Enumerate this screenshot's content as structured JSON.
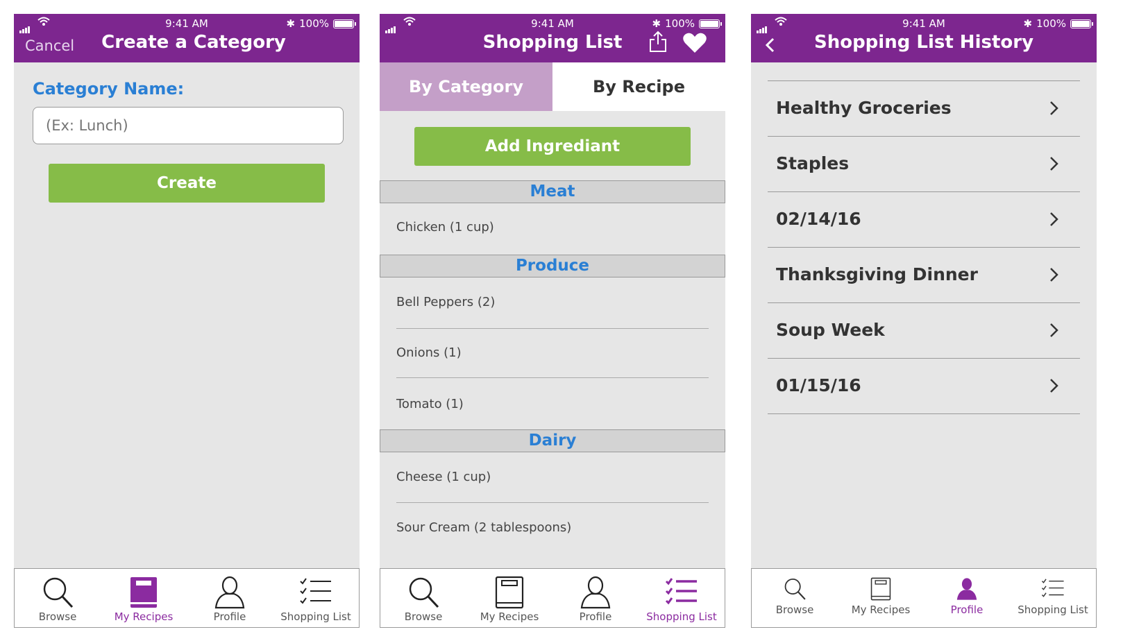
{
  "status": {
    "time": "9:41 AM",
    "battery": "100%"
  },
  "screen1": {
    "cancel": "Cancel",
    "title": "Create a Category",
    "category_label": "Category Name:",
    "input_placeholder": "(Ex: Lunch)",
    "create_label": "Create"
  },
  "screen2": {
    "title": "Shopping List",
    "seg_category": "By Category",
    "seg_recipe": "By Recipe",
    "add_label": "Add Ingrediant",
    "sections": [
      {
        "name": "Meat",
        "items": [
          "Chicken (1 cup)"
        ]
      },
      {
        "name": "Produce",
        "items": [
          "Bell Peppers (2)",
          "Onions (1)",
          "Tomato (1)"
        ]
      },
      {
        "name": "Dairy",
        "items": [
          "Cheese (1 cup)",
          "Sour Cream (2 tablespoons)"
        ]
      }
    ]
  },
  "screen3": {
    "title": "Shopping List History",
    "lists": [
      "Healthy Groceries",
      "Staples",
      "02/14/16",
      "Thanksgiving Dinner",
      "Soup Week",
      "01/15/16"
    ]
  },
  "tabs": {
    "browse": "Browse",
    "recipes": "My Recipes",
    "profile": "Profile",
    "shopping": "Shopping List"
  },
  "colors": {
    "header": "#7d268f",
    "accent_green": "#86bc48",
    "section_blue": "#2a7fd4",
    "active_tab": "#8b2ba0"
  },
  "icons": [
    "search-icon",
    "book-icon",
    "person-icon",
    "checklist-icon",
    "share-icon",
    "heart-icon",
    "chevron-right-icon",
    "back-chevron-icon",
    "signal-icon",
    "wifi-icon",
    "bluetooth-icon",
    "battery-icon"
  ]
}
